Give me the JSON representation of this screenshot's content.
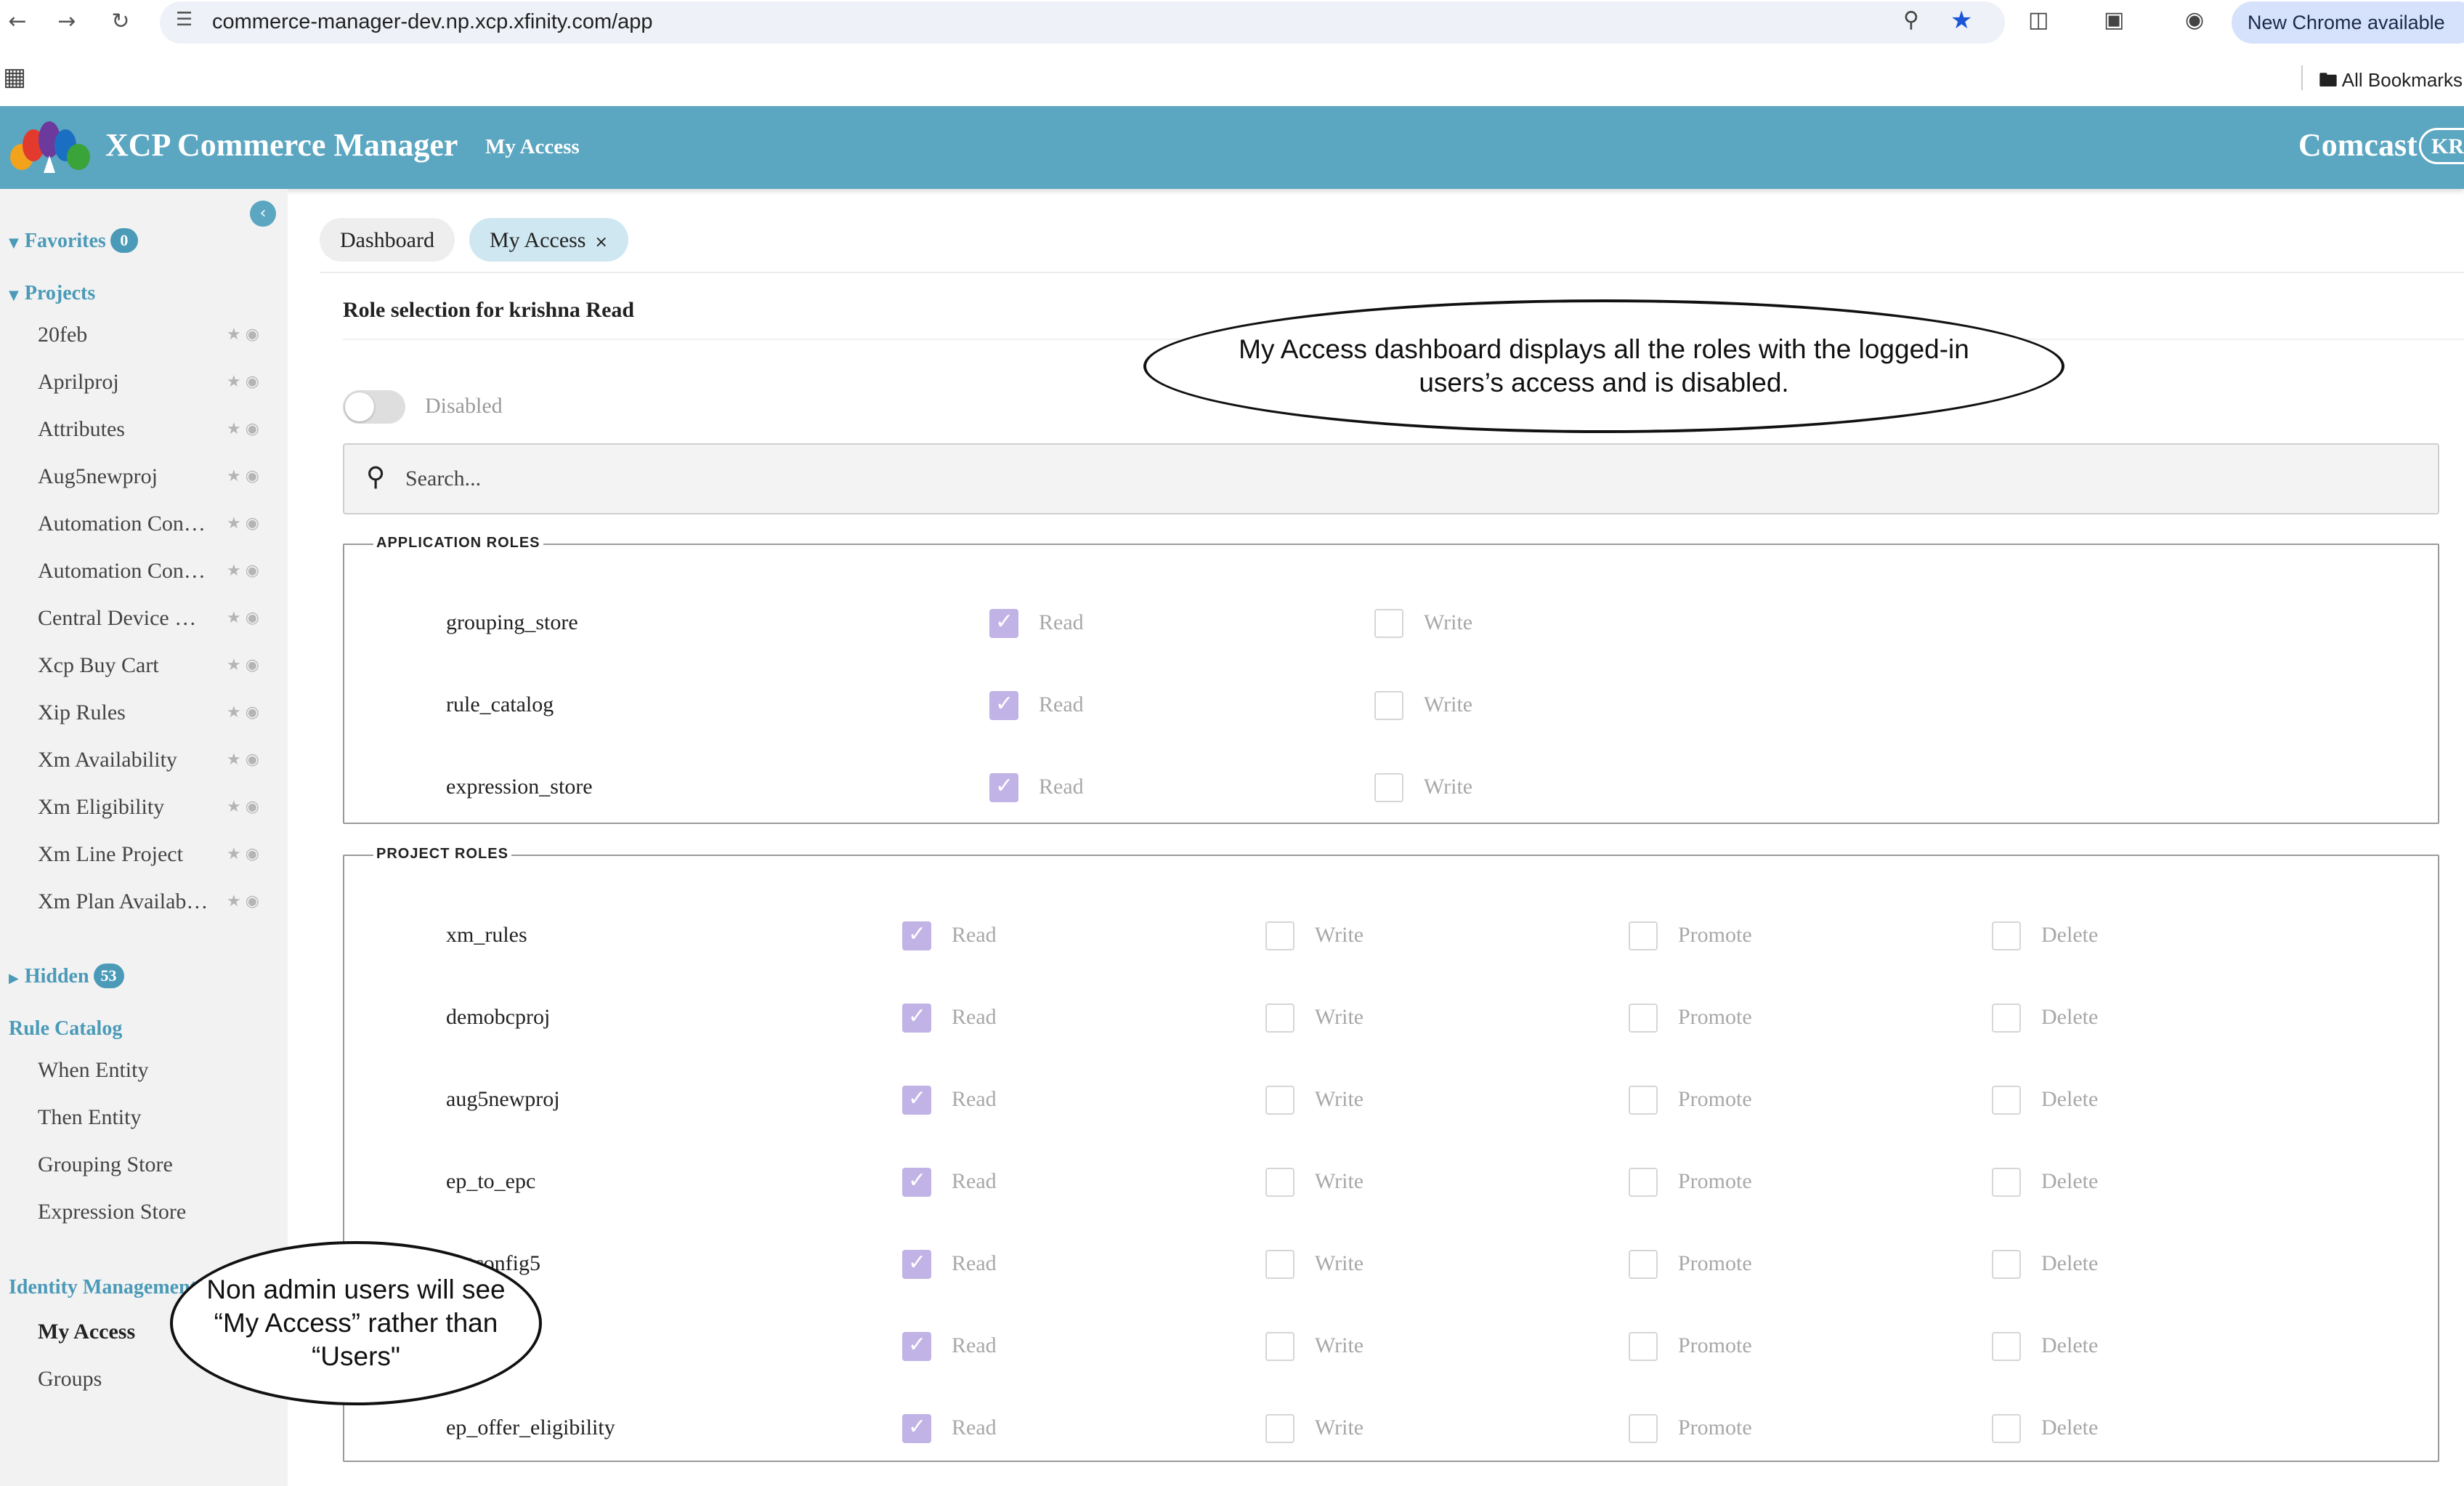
{
  "browser": {
    "url": "commerce-manager-dev.np.xcp.xfinity.com/app",
    "chrome_notice": "New Chrome available",
    "bookmarks_label": "All Bookmarks"
  },
  "header": {
    "app_title": "XCP Commerce Manager",
    "nav_link": "My Access",
    "brand": "Comcast",
    "user_initials": "KR"
  },
  "sidebar": {
    "favorites": {
      "label": "Favorites",
      "count": "0"
    },
    "projects": {
      "label": "Projects",
      "items": [
        "20feb",
        "Aprilproj",
        "Attributes",
        "Aug5newproj",
        "Automation Con…",
        "Automation Con…",
        "Central Device …",
        "Xcp Buy Cart",
        "Xip Rules",
        "Xm Availability",
        "Xm Eligibility",
        "Xm Line Project",
        "Xm Plan Availab…"
      ]
    },
    "hidden": {
      "label": "Hidden",
      "count": "53"
    },
    "rule_catalog": {
      "label": "Rule Catalog",
      "items": [
        "When Entity",
        "Then Entity",
        "Grouping Store",
        "Expression Store"
      ]
    },
    "identity_management": {
      "label": "Identity Management",
      "items": [
        "My Access",
        "Groups"
      ]
    }
  },
  "tabs": [
    {
      "label": "Dashboard"
    },
    {
      "label": "My Access",
      "close": "×"
    }
  ],
  "main": {
    "role_title": "Role selection for krishna Read",
    "toggle_label": "Disabled",
    "search_placeholder": "Search...",
    "application_roles": {
      "legend": "APPLICATION ROLES",
      "perms": [
        "Read",
        "Write"
      ],
      "rows": [
        {
          "name": "grouping_store",
          "checked": [
            true,
            false
          ]
        },
        {
          "name": "rule_catalog",
          "checked": [
            true,
            false
          ]
        },
        {
          "name": "expression_store",
          "checked": [
            true,
            false
          ]
        }
      ]
    },
    "project_roles": {
      "legend": "PROJECT ROLES",
      "perms": [
        "Read",
        "Write",
        "Promote",
        "Delete"
      ],
      "rows": [
        {
          "name": "xm_rules",
          "checked": [
            true,
            false,
            false,
            false
          ]
        },
        {
          "name": "demobcproj",
          "checked": [
            true,
            false,
            false,
            false
          ]
        },
        {
          "name": "aug5newproj",
          "checked": [
            true,
            false,
            false,
            false
          ]
        },
        {
          "name": "ep_to_epc",
          "checked": [
            true,
            false,
            false,
            false
          ]
        },
        {
          "name": "…tconfig5",
          "checked": [
            true,
            false,
            false,
            false
          ]
        },
        {
          "name": "…j",
          "checked": [
            true,
            false,
            false,
            false
          ]
        },
        {
          "name": "ep_offer_eligibility",
          "checked": [
            true,
            false,
            false,
            false
          ]
        }
      ]
    }
  },
  "annotations": {
    "dashboard_note": "My Access dashboard displays all the roles with the logged-in users’s access and is disabled.",
    "sidebar_note": "Non admin users will see “My Access” rather than “Users\""
  },
  "colors": {
    "header": "#5ba6c1",
    "accent": "#4a9ab8",
    "checkbox_checked": "#c1b3e6"
  },
  "icons": {
    "favorite": "star-icon",
    "visibility": "eye-icon",
    "search": "search-icon",
    "collapse": "chevron-left-icon"
  }
}
